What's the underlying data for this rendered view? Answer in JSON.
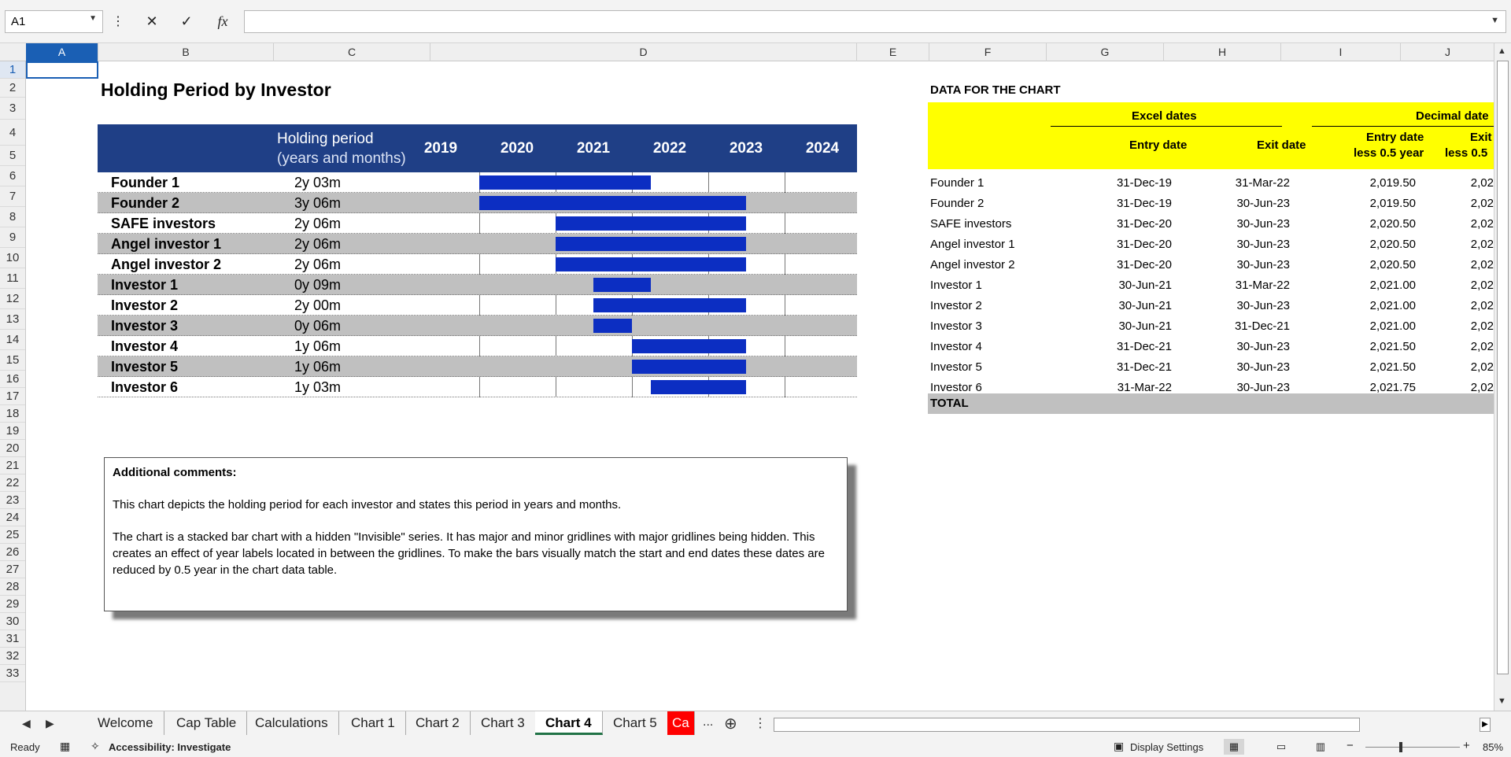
{
  "formula_bar": {
    "name_box": "A1",
    "cancel_icon": "✕",
    "enter_icon": "✓",
    "fx_label": "fx",
    "formula": ""
  },
  "columns": [
    "A",
    "B",
    "C",
    "D",
    "E",
    "F",
    "G",
    "H",
    "I",
    "J"
  ],
  "rows": [
    "1",
    "2",
    "3",
    "4",
    "5",
    "6",
    "7",
    "8",
    "9",
    "10",
    "11",
    "12",
    "13",
    "14",
    "15",
    "16",
    "17",
    "18",
    "19",
    "20",
    "21",
    "22",
    "23",
    "24",
    "25",
    "26",
    "27",
    "28",
    "29",
    "30",
    "31",
    "32",
    "33"
  ],
  "chart": {
    "title": "Holding Period by Investor",
    "header_line1": "Holding period",
    "header_line2": "(years and months)",
    "years": [
      "2019",
      "2020",
      "2021",
      "2022",
      "2023",
      "2024"
    ],
    "rows": [
      {
        "name": "Founder 1",
        "period": "2y 03m",
        "start": 2020.0,
        "end": 2022.25
      },
      {
        "name": "Founder 2",
        "period": "3y 06m",
        "start": 2020.0,
        "end": 2023.5
      },
      {
        "name": "SAFE investors",
        "period": "2y 06m",
        "start": 2021.0,
        "end": 2023.5
      },
      {
        "name": "Angel investor 1",
        "period": "2y 06m",
        "start": 2021.0,
        "end": 2023.5
      },
      {
        "name": "Angel investor 2",
        "period": "2y 06m",
        "start": 2021.0,
        "end": 2023.5
      },
      {
        "name": "Investor 1",
        "period": "0y 09m",
        "start": 2021.5,
        "end": 2022.25
      },
      {
        "name": "Investor 2",
        "period": "2y 00m",
        "start": 2021.5,
        "end": 2023.5
      },
      {
        "name": "Investor 3",
        "period": "0y 06m",
        "start": 2021.5,
        "end": 2022.0
      },
      {
        "name": "Investor 4",
        "period": "1y 06m",
        "start": 2022.0,
        "end": 2023.5
      },
      {
        "name": "Investor 5",
        "period": "1y 06m",
        "start": 2022.0,
        "end": 2023.5
      },
      {
        "name": "Investor 6",
        "period": "1y 03m",
        "start": 2022.25,
        "end": 2023.5
      }
    ],
    "bar_color": "#0c2ec2",
    "header_color": "#1f3f86"
  },
  "chart_data": {
    "type": "bar",
    "title": "Holding Period by Investor",
    "categories": [
      "Founder 1",
      "Founder 2",
      "SAFE investors",
      "Angel investor 1",
      "Angel investor 2",
      "Investor 1",
      "Investor 2",
      "Investor 3",
      "Investor 4",
      "Investor 5",
      "Investor 6"
    ],
    "series": [
      {
        "name": "Invisible",
        "values": [
          2019.5,
          2019.5,
          2020.5,
          2020.5,
          2020.5,
          2021.0,
          2021.0,
          2021.0,
          2021.5,
          2021.5,
          2021.75
        ]
      },
      {
        "name": "Holding period",
        "values": [
          2.25,
          3.5,
          2.5,
          2.5,
          2.5,
          0.75,
          2.0,
          0.5,
          1.5,
          1.5,
          1.25
        ]
      }
    ],
    "xlim": [
      2019,
      2025
    ]
  },
  "comments": {
    "heading": "Additional comments:",
    "p1": "This chart depicts the holding period for each investor and states this period in years and months.",
    "p2": "The chart is a stacked bar chart with a hidden \"Invisible\" series. It has major and minor gridlines with major gridlines being hidden. This creates an effect of year labels located in between the gridlines. To make the bars visually match the start and end dates these dates are reduced by 0.5 year in the chart data table."
  },
  "data_table": {
    "title": "DATA FOR THE CHART",
    "group1": "Excel dates",
    "group2": "Decimal date",
    "col_entry": "Entry date",
    "col_exit": "Exit date",
    "col_entry_dec1": "Entry date",
    "col_entry_dec2": "less 0.5 year",
    "col_exit_dec1": "Exit",
    "col_exit_dec2": "less 0.5",
    "rows": [
      {
        "name": "Founder 1",
        "entry": "31-Dec-19",
        "exit": "31-Mar-22",
        "entry_dec": "2,019.50",
        "exit_dec": "2,02"
      },
      {
        "name": "Founder 2",
        "entry": "31-Dec-19",
        "exit": "30-Jun-23",
        "entry_dec": "2,019.50",
        "exit_dec": "2,02"
      },
      {
        "name": "SAFE investors",
        "entry": "31-Dec-20",
        "exit": "30-Jun-23",
        "entry_dec": "2,020.50",
        "exit_dec": "2,02"
      },
      {
        "name": "Angel investor 1",
        "entry": "31-Dec-20",
        "exit": "30-Jun-23",
        "entry_dec": "2,020.50",
        "exit_dec": "2,02"
      },
      {
        "name": "Angel investor 2",
        "entry": "31-Dec-20",
        "exit": "30-Jun-23",
        "entry_dec": "2,020.50",
        "exit_dec": "2,02"
      },
      {
        "name": "Investor 1",
        "entry": "30-Jun-21",
        "exit": "31-Mar-22",
        "entry_dec": "2,021.00",
        "exit_dec": "2,02"
      },
      {
        "name": "Investor 2",
        "entry": "30-Jun-21",
        "exit": "30-Jun-23",
        "entry_dec": "2,021.00",
        "exit_dec": "2,02"
      },
      {
        "name": "Investor 3",
        "entry": "30-Jun-21",
        "exit": "31-Dec-21",
        "entry_dec": "2,021.00",
        "exit_dec": "2,02"
      },
      {
        "name": "Investor 4",
        "entry": "31-Dec-21",
        "exit": "30-Jun-23",
        "entry_dec": "2,021.50",
        "exit_dec": "2,02"
      },
      {
        "name": "Investor 5",
        "entry": "31-Dec-21",
        "exit": "30-Jun-23",
        "entry_dec": "2,021.50",
        "exit_dec": "2,02"
      },
      {
        "name": "Investor 6",
        "entry": "31-Mar-22",
        "exit": "30-Jun-23",
        "entry_dec": "2,021.75",
        "exit_dec": "2,02"
      }
    ],
    "total": "TOTAL",
    "header_color": "#ffff00"
  },
  "tabs": [
    "Welcome",
    "Cap Table",
    "Calculations",
    "Chart 1",
    "Chart 2",
    "Chart 3",
    "Chart 4",
    "Chart 5",
    "Ca"
  ],
  "active_tab": "Chart 4",
  "tab_more": "...",
  "status": {
    "ready": "Ready",
    "accessibility": "Accessibility: Investigate",
    "display_settings": "Display Settings",
    "zoom": "85%",
    "zoom_fraction": 0.85
  }
}
